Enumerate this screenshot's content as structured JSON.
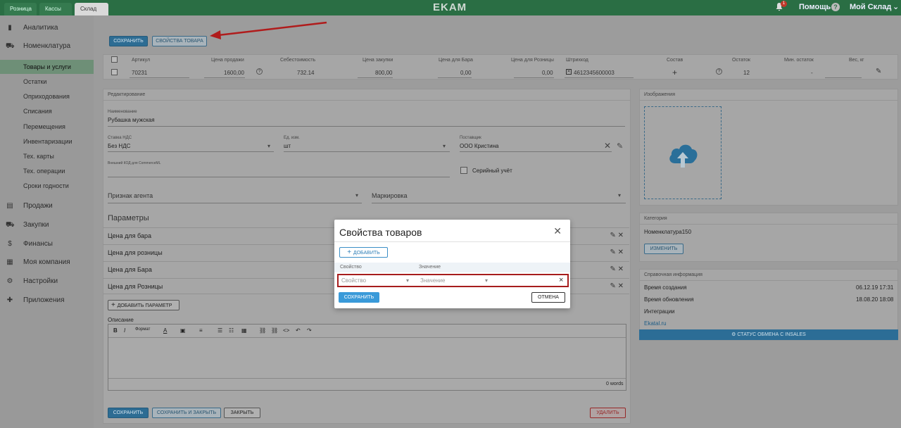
{
  "topbar": {
    "tabs": [
      "Розница",
      "Кассы",
      "Склад"
    ],
    "logo": "EKAM",
    "notification_count": "1",
    "help_label": "Помощь",
    "account_label": "Мой Склад"
  },
  "sidebar": {
    "items": [
      {
        "label": "Аналитика",
        "icon": "bar-chart-icon"
      },
      {
        "label": "Номенклатура",
        "icon": "cart-icon"
      },
      {
        "label": "Товары и услуги"
      },
      {
        "label": "Остатки"
      },
      {
        "label": "Оприходования"
      },
      {
        "label": "Списания"
      },
      {
        "label": "Перемещения"
      },
      {
        "label": "Инвентаризации"
      },
      {
        "label": "Тех. карты"
      },
      {
        "label": "Тех. операции"
      },
      {
        "label": "Сроки годности"
      },
      {
        "label": "Продажи",
        "icon": "register-icon"
      },
      {
        "label": "Закупки",
        "icon": "truck-icon"
      },
      {
        "label": "Финансы",
        "icon": "dollar-icon"
      },
      {
        "label": "Моя компания",
        "icon": "building-icon"
      },
      {
        "label": "Настройки",
        "icon": "gear-icon"
      },
      {
        "label": "Приложения",
        "icon": "puzzle-icon"
      }
    ]
  },
  "toolbar": {
    "save_label": "Сохранить",
    "properties_label": "Свойства товара"
  },
  "table": {
    "headers": [
      "Артикул",
      "Цена продажи",
      "Себестоимость",
      "Цена закупки",
      "Цена для Бара",
      "Цена для Розницы",
      "Штрихкод",
      "Состав",
      "Остаток",
      "Мин. остаток",
      "Вес, кг"
    ],
    "row": {
      "article": "70231",
      "sale_price": "1600,00",
      "cost": "732.14",
      "purchase_price": "800,00",
      "bar_price": "0,00",
      "retail_price": "0,00",
      "barcode": "4612345600003",
      "composition": "+",
      "stock": "12",
      "min_stock": "-",
      "weight": ""
    }
  },
  "edit": {
    "section_title": "Редактирование",
    "name_label": "Наименование",
    "name_value": "Рубашка мужская",
    "vat_label": "Ставка НДС",
    "vat_value": "Без НДС",
    "unit_label": "Ед. изм.",
    "unit_value": "шт",
    "supplier_label": "Поставщик",
    "supplier_value": "ООО Кристина",
    "external_code_label": "Внешний КОД для CommerceML",
    "serial_label": "Серийный учёт",
    "agent_label": "Признак агента",
    "marking_label": "Маркировка",
    "params_title": "Параметры",
    "params": [
      "Цена для бара",
      "Цена для розницы",
      "Цена для Бара",
      "Цена для Розницы"
    ],
    "add_param_label": "Добавить параметр",
    "description_label": "Описание",
    "format_label": "Формат",
    "words_count": "0 words",
    "footer": {
      "save": "Сохранить",
      "save_close": "Сохранить и закрыть",
      "close": "Закрыть",
      "delete": "Удалить"
    }
  },
  "right": {
    "images_title": "Изображения",
    "category_title": "Категория",
    "category_value": "Номенклатура150",
    "change_label": "Изменить",
    "info_title": "Справочная информация",
    "created_label": "Время создания",
    "created_value": "06.12.19 17:31",
    "updated_label": "Время обновления",
    "updated_value": "18.08.20 18:08",
    "integrations_label": "Интеграции",
    "integration_link": "Ekatal.ru",
    "insales_button": "Статус обмена с InSales"
  },
  "modal": {
    "title": "Свойства товаров",
    "add_label": "Добавить",
    "col_property": "Свойство",
    "col_value": "Значение",
    "property_placeholder": "Свойство",
    "value_placeholder": "Значение",
    "save_label": "Сохранить",
    "cancel_label": "Отмена"
  },
  "colors": {
    "brand_green": "#2a6e44",
    "accent_blue": "#3a9ad9",
    "highlight_red": "#a61d1d"
  }
}
